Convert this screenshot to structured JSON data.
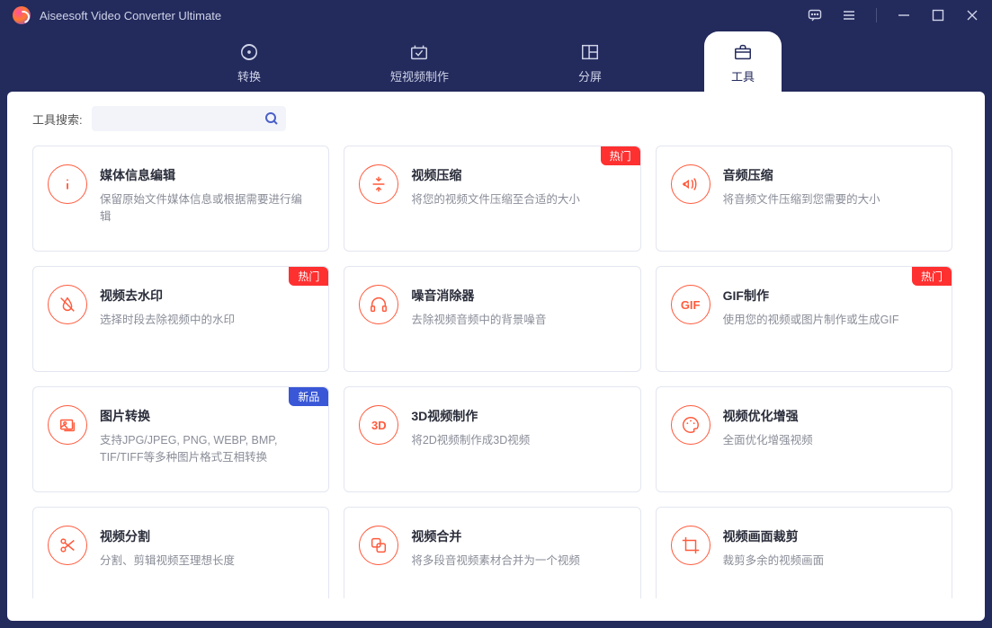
{
  "app": {
    "title": "Aiseesoft Video Converter Ultimate"
  },
  "tabs": [
    {
      "label": "转换"
    },
    {
      "label": "短视频制作"
    },
    {
      "label": "分屏"
    },
    {
      "label": "工具"
    }
  ],
  "search": {
    "label": "工具搜索:",
    "placeholder": ""
  },
  "badge": {
    "hot": "热门",
    "new": "新品"
  },
  "tools": [
    {
      "title": "媒体信息编辑",
      "desc": "保留原始文件媒体信息或根据需要进行编辑",
      "badge": null
    },
    {
      "title": "视频压缩",
      "desc": "将您的视频文件压缩至合适的大小",
      "badge": "hot"
    },
    {
      "title": "音频压缩",
      "desc": "将音频文件压缩到您需要的大小",
      "badge": null
    },
    {
      "title": "视频去水印",
      "desc": "选择时段去除视频中的水印",
      "badge": "hot"
    },
    {
      "title": "噪音消除器",
      "desc": "去除视频音频中的背景噪音",
      "badge": null
    },
    {
      "title": "GIF制作",
      "desc": "使用您的视频或图片制作或生成GIF",
      "badge": "hot"
    },
    {
      "title": "图片转换",
      "desc": "支持JPG/JPEG, PNG, WEBP, BMP, TIF/TIFF等多种图片格式互相转换",
      "badge": "new"
    },
    {
      "title": "3D视频制作",
      "desc": "将2D视频制作成3D视频",
      "badge": null
    },
    {
      "title": "视频优化增强",
      "desc": "全面优化增强视频",
      "badge": null
    },
    {
      "title": "视频分割",
      "desc": "分割、剪辑视频至理想长度",
      "badge": null
    },
    {
      "title": "视频合并",
      "desc": "将多段音视频素材合并为一个视频",
      "badge": null
    },
    {
      "title": "视频画面裁剪",
      "desc": "裁剪多余的视频画面",
      "badge": null
    }
  ]
}
